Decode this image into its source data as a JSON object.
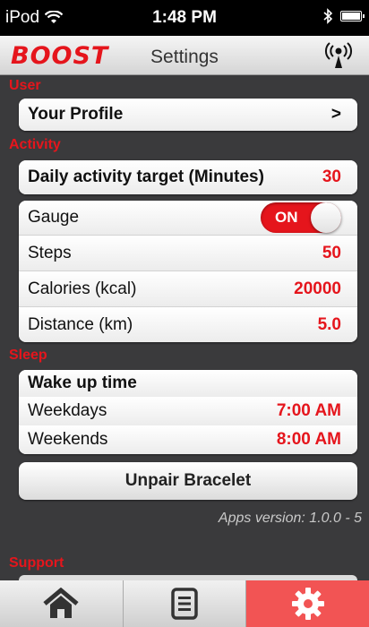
{
  "status_bar": {
    "carrier": "iPod",
    "time": "1:48 PM"
  },
  "nav": {
    "logo": "BOOST",
    "title": "Settings"
  },
  "sections": {
    "user": "User",
    "activity": "Activity",
    "sleep": "Sleep",
    "support": "Support"
  },
  "user": {
    "profile_label": "Your Profile",
    "profile_chevron": ">"
  },
  "activity": {
    "daily_target_label": "Daily activity target (Minutes)",
    "daily_target_value": "30",
    "gauge_label": "Gauge",
    "gauge_toggle": "ON",
    "steps_label": "Steps",
    "steps_value": "50",
    "calories_label": "Calories (kcal)",
    "calories_value": "20000",
    "distance_label": "Distance (km)",
    "distance_value": "5.0"
  },
  "sleep": {
    "wake_label": "Wake up time",
    "weekdays_label": "Weekdays",
    "weekdays_value": "7:00 AM",
    "weekends_label": "Weekends",
    "weekends_value": "8:00 AM"
  },
  "unpair_label": "Unpair Bracelet",
  "version": "Apps version: 1.0.0 - 5",
  "colors": {
    "accent": "#e5151c",
    "active_tab": "#f25454",
    "background": "#3a3a3c"
  },
  "tabs": [
    {
      "icon": "home-icon",
      "active": false
    },
    {
      "icon": "list-icon",
      "active": false
    },
    {
      "icon": "gear-icon",
      "active": true
    }
  ]
}
